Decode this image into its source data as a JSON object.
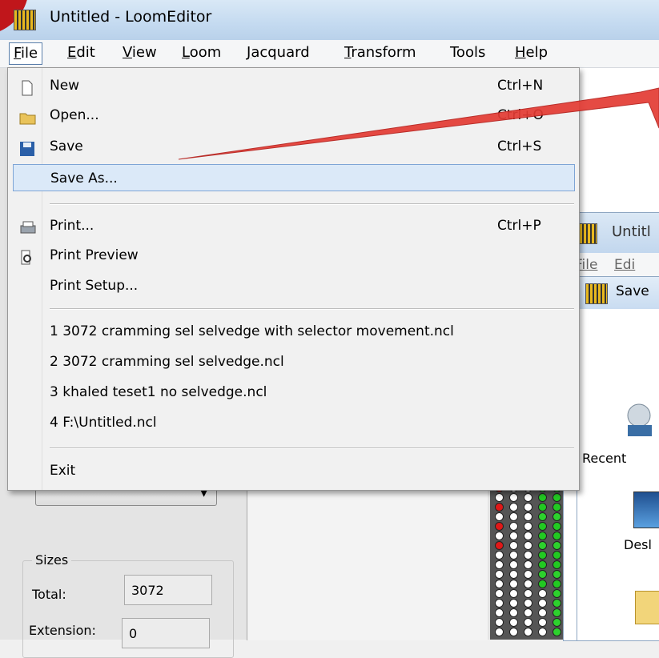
{
  "window": {
    "title": "Untitled - LoomEditor"
  },
  "menubar": [
    {
      "label": "File",
      "mnemonic": "F",
      "rest": "ile"
    },
    {
      "label": "Edit",
      "mnemonic": "E",
      "rest": "dit"
    },
    {
      "label": "View",
      "mnemonic": "V",
      "rest": "iew"
    },
    {
      "label": "Loom",
      "mnemonic": "L",
      "rest": "oom"
    },
    {
      "label": "Jacquard",
      "mnemonic": "J",
      "rest": "acquard"
    },
    {
      "label": "Transform",
      "mnemonic": "T",
      "rest": "ransform"
    },
    {
      "label": "Tools",
      "mnemonic": "",
      "rest": "Tools"
    },
    {
      "label": "Help",
      "mnemonic": "H",
      "rest": "elp"
    }
  ],
  "file_menu": {
    "new": {
      "label": "New",
      "shortcut": "Ctrl+N"
    },
    "open": {
      "label": "Open...",
      "shortcut": "Ctrl+O"
    },
    "save": {
      "label": "Save",
      "shortcut": "Ctrl+S"
    },
    "save_as": {
      "label": "Save As..."
    },
    "print": {
      "label": "Print...",
      "shortcut": "Ctrl+P"
    },
    "print_preview": {
      "label": "Print Preview"
    },
    "print_setup": {
      "label": "Print Setup..."
    },
    "recent": [
      "1 3072 cramming sel selvedge with selector movement.ncl",
      "2 3072 cramming sel selvedge.ncl",
      "3 khaled teset1 no selvedge.ncl",
      "4 F:\\Untitled.ncl"
    ],
    "exit": {
      "label": "Exit"
    }
  },
  "sizes": {
    "legend": "Sizes",
    "total_label": "Total:",
    "total_value": "3072",
    "extension_label": "Extension:",
    "extension_value": "0"
  },
  "second_window": {
    "title": "Untitl",
    "menu_file": "File",
    "menu_edit": "Edi"
  },
  "save_dialog": {
    "title": "Save",
    "recent_label": "Recent",
    "desktop_label": "Desl"
  }
}
